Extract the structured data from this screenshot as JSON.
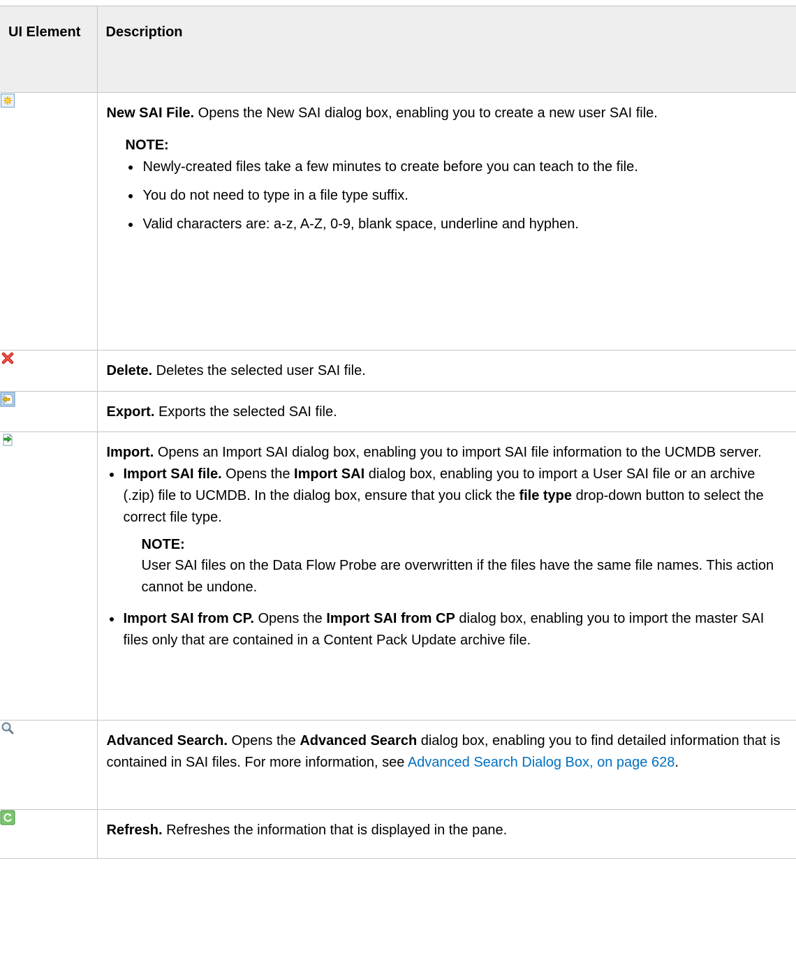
{
  "header": {
    "col1": "UI Element",
    "col2": "Description"
  },
  "rows": [
    {
      "icon": "new-file-star-icon",
      "title": "New SAI File.",
      "text": " Opens the New SAI dialog box, enabling you to create a new user SAI file.",
      "note": {
        "label": "NOTE:",
        "items": [
          "Newly-created files take a few minutes to create before you can teach to the file.",
          "You do not need to type in a file type suffix.",
          "Valid characters are: a-z, A-Z, 0-9, blank space, underline and hyphen."
        ]
      }
    },
    {
      "icon": "delete-x-icon",
      "title": "Delete.",
      "text": " Deletes the selected user SAI file."
    },
    {
      "icon": "export-icon",
      "title": "Export.",
      "text": " Exports the selected SAI file."
    },
    {
      "icon": "import-icon",
      "title": "Import.",
      "text": " Opens an Import SAI dialog box, enabling you to import SAI file information to the UCMDB server.",
      "sub_items": [
        {
          "title": "Import SAI file.",
          "t1": " Opens the ",
          "b1": "Import SAI",
          "t2": " dialog box, enabling you to import a User SAI file or an archive (.zip) file to UCMDB. In the dialog box, ensure that you click the ",
          "b2": "file type",
          "t3": " drop-down button to select the correct file type.",
          "note_label": "NOTE:",
          "note_text": "User SAI files on the Data Flow Probe are overwritten if the files have the same file names. This action cannot be undone."
        },
        {
          "title": "Import SAI from CP.",
          "t1": " Opens the ",
          "b1": "Import SAI from CP",
          "t2": " dialog box, enabling you to import the master SAI files only that are contained in a Content Pack Update archive file."
        }
      ]
    },
    {
      "icon": "magnifier-icon",
      "title": "Advanced Search.",
      "t1": " Opens the ",
      "b1": "Advanced Search",
      "t2": " dialog box, enabling you to find detailed information that is contained in SAI files. For more information, see ",
      "link": "Advanced Search Dialog Box, on page 628",
      "t3": "."
    },
    {
      "icon": "refresh-icon",
      "title": "Refresh.",
      "text": " Refreshes the information that is displayed in the pane."
    }
  ]
}
